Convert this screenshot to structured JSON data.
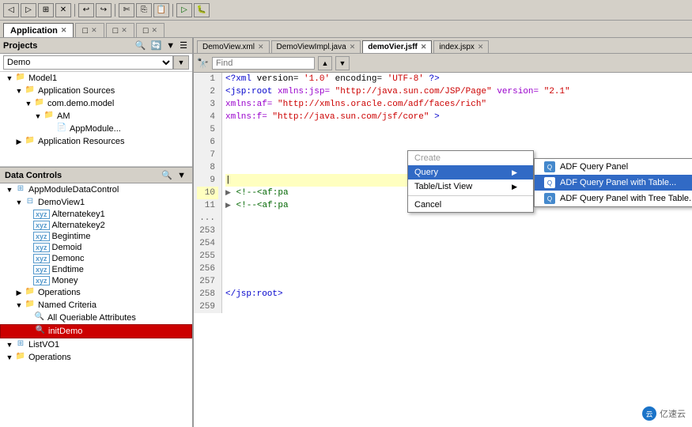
{
  "toolbar": {
    "buttons": [
      "◀",
      "▶",
      "⊞",
      "✕",
      "↩",
      "↪",
      "✄",
      "⎘",
      "⊟",
      "⊕",
      "⊘",
      "▷",
      "⚙"
    ]
  },
  "tabs": [
    {
      "label": "Application",
      "active": false,
      "closeable": true
    },
    {
      "label": "□",
      "active": false,
      "closeable": true
    },
    {
      "label": "□",
      "active": false,
      "closeable": true
    },
    {
      "label": "□",
      "active": false,
      "closeable": true
    }
  ],
  "editor_tabs": [
    {
      "label": "DemoView.xml",
      "active": false
    },
    {
      "label": "DemoViewImpl.java",
      "active": false
    },
    {
      "label": "demoVier.jsff",
      "active": true
    },
    {
      "label": "index.jspx",
      "active": false
    }
  ],
  "navigator": {
    "dropdown_value": "Demo",
    "section_label": "Projects"
  },
  "tree": {
    "items": [
      {
        "level": 0,
        "expanded": true,
        "label": "Model1",
        "type": "folder",
        "has_expand": true
      },
      {
        "level": 1,
        "expanded": true,
        "label": "Application Sources",
        "type": "folder",
        "has_expand": true
      },
      {
        "level": 2,
        "expanded": true,
        "label": "com.demo.model",
        "type": "folder",
        "has_expand": true
      },
      {
        "level": 3,
        "expanded": true,
        "label": "AM",
        "type": "folder",
        "has_expand": true
      },
      {
        "level": 4,
        "expanded": false,
        "label": "AppModule...",
        "type": "file",
        "has_expand": false
      },
      {
        "level": 1,
        "expanded": false,
        "label": "Application Resources",
        "type": "folder",
        "has_expand": false
      }
    ]
  },
  "data_controls": {
    "label": "Data Controls",
    "items": [
      {
        "level": 0,
        "expanded": true,
        "label": "AppModuleDataControl",
        "type": "db",
        "has_expand": true
      },
      {
        "level": 1,
        "expanded": true,
        "label": "DemoView1",
        "type": "db",
        "has_expand": true
      },
      {
        "level": 2,
        "expanded": false,
        "label": "Alternatekey1",
        "type": "db-small",
        "has_expand": false
      },
      {
        "level": 2,
        "expanded": false,
        "label": "Alternatekey2",
        "type": "db-small",
        "has_expand": false
      },
      {
        "level": 2,
        "expanded": false,
        "label": "Begintime",
        "type": "db-small",
        "has_expand": false
      },
      {
        "level": 2,
        "expanded": false,
        "label": "Demoid",
        "type": "db-small",
        "has_expand": false
      },
      {
        "level": 2,
        "expanded": false,
        "label": "Demonc",
        "type": "db-small",
        "has_expand": false
      },
      {
        "level": 2,
        "expanded": false,
        "label": "Endtime",
        "type": "db-small",
        "has_expand": false
      },
      {
        "level": 2,
        "expanded": false,
        "label": "Money",
        "type": "db-small",
        "has_expand": false
      },
      {
        "level": 1,
        "expanded": true,
        "label": "Operations",
        "type": "folder",
        "has_expand": true
      },
      {
        "level": 1,
        "expanded": true,
        "label": "Named Criteria",
        "type": "folder",
        "has_expand": true
      },
      {
        "level": 2,
        "expanded": false,
        "label": "All Queriable Attributes",
        "type": "criteria",
        "has_expand": false
      },
      {
        "level": 2,
        "expanded": false,
        "label": "initDemo",
        "type": "criteria",
        "has_expand": false,
        "highlighted": true
      },
      {
        "level": 0,
        "expanded": true,
        "label": "ListVO1",
        "type": "db",
        "has_expand": true
      },
      {
        "level": 0,
        "expanded": true,
        "label": "Operations",
        "type": "folder",
        "has_expand": true
      }
    ]
  },
  "editor": {
    "find_placeholder": "Find",
    "lines": [
      {
        "num": 1,
        "content": "<?xml version='1.0' encoding='UTF-8'?>",
        "type": "xml"
      },
      {
        "num": 2,
        "content": "<jsp:root xmlns:jsp=\"http://java.sun.com/JSP/Page\" version=\"2.1\"",
        "type": "xml"
      },
      {
        "num": 3,
        "content": "          xmlns:af=\"http://xmlns.oracle.com/adf/faces/rich\"",
        "type": "xml"
      },
      {
        "num": 4,
        "content": "          xmlns:f=\"http://java.sun.com/jsf/core\">",
        "type": "xml"
      },
      {
        "num": 5,
        "content": "",
        "type": "empty"
      },
      {
        "num": 6,
        "content": "",
        "type": "empty"
      },
      {
        "num": 7,
        "content": "",
        "type": "empty"
      },
      {
        "num": 8,
        "content": "",
        "type": "empty"
      },
      {
        "num": 9,
        "content": "  |",
        "type": "cursor",
        "highlighted": true
      },
      {
        "num": 10,
        "content": "  <!--<af:pa",
        "type": "xml",
        "expand": true
      },
      {
        "num": 11,
        "content": "  <!--<af:pa",
        "type": "xml",
        "expand": true
      },
      {
        "num": "...",
        "content": "",
        "type": "empty"
      },
      {
        "num": 253,
        "content": "",
        "type": "empty"
      },
      {
        "num": 254,
        "content": "",
        "type": "empty"
      },
      {
        "num": 255,
        "content": "",
        "type": "empty"
      },
      {
        "num": 256,
        "content": "",
        "type": "empty"
      },
      {
        "num": 257,
        "content": "",
        "type": "empty"
      },
      {
        "num": 258,
        "content": "  </jsp:root>",
        "type": "xml"
      },
      {
        "num": 259,
        "content": "",
        "type": "empty"
      }
    ]
  },
  "context_menu": {
    "items": [
      {
        "label": "Create",
        "disabled": true,
        "has_submenu": false
      },
      {
        "label": "Query",
        "active": true,
        "has_submenu": true
      },
      {
        "label": "Table/List View",
        "has_submenu": true
      },
      {
        "label": "Cancel",
        "has_submenu": false
      }
    ]
  },
  "submenu": {
    "items": [
      {
        "label": "ADF Query Panel",
        "active": false
      },
      {
        "label": "ADF Query Panel with Table...",
        "active": true
      },
      {
        "label": "ADF Query Panel with Tree Table...",
        "active": false
      }
    ]
  },
  "watermark": {
    "text": "亿速云",
    "icon": "云"
  }
}
